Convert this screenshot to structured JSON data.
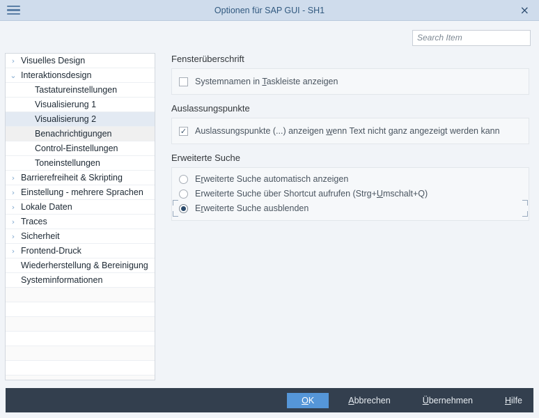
{
  "window": {
    "title": "Optionen für SAP GUI - SH1",
    "menu_icon": "hamburger-icon",
    "close_icon": "×"
  },
  "search": {
    "placeholder": "Search Item",
    "value": ""
  },
  "sidebar": {
    "items": [
      {
        "label": "Visuelles Design",
        "level": 1,
        "chevron": "›",
        "state": "collapsed"
      },
      {
        "label": "Interaktionsdesign",
        "level": 1,
        "chevron": "⌄",
        "state": "expanded"
      },
      {
        "label": "Tastatureinstellungen",
        "level": 2,
        "chevron": "",
        "state": "leaf"
      },
      {
        "label": "Visualisierung 1",
        "level": 2,
        "chevron": "",
        "state": "leaf"
      },
      {
        "label": "Visualisierung 2",
        "level": 2,
        "chevron": "",
        "state": "selected"
      },
      {
        "label": "Benachrichtigungen",
        "level": 2,
        "chevron": "",
        "state": "hover"
      },
      {
        "label": "Control-Einstellungen",
        "level": 2,
        "chevron": "",
        "state": "leaf"
      },
      {
        "label": "Toneinstellungen",
        "level": 2,
        "chevron": "",
        "state": "leaf"
      },
      {
        "label": "Barrierefreiheit & Skripting",
        "level": 1,
        "chevron": "›",
        "state": "collapsed"
      },
      {
        "label": "Einstellung - mehrere Sprachen",
        "level": 1,
        "chevron": "›",
        "state": "collapsed"
      },
      {
        "label": "Lokale Daten",
        "level": 1,
        "chevron": "›",
        "state": "collapsed"
      },
      {
        "label": "Traces",
        "level": 1,
        "chevron": "›",
        "state": "collapsed"
      },
      {
        "label": "Sicherheit",
        "level": 1,
        "chevron": "›",
        "state": "collapsed"
      },
      {
        "label": "Frontend-Druck",
        "level": 1,
        "chevron": "›",
        "state": "collapsed"
      },
      {
        "label": "Wiederherstellung & Bereinigung",
        "level": 1,
        "chevron": "",
        "state": "leaf"
      },
      {
        "label": "Systeminformationen",
        "level": 1,
        "chevron": "",
        "state": "leaf"
      }
    ],
    "empty_row_count": 7
  },
  "main": {
    "groups": [
      {
        "title": "Fensterüberschrift",
        "control": "checkbox",
        "options": [
          {
            "label_before": "Systemnamen in ",
            "accel": "T",
            "label_after": "askleiste anzeigen",
            "checked": false
          }
        ]
      },
      {
        "title": "Auslassungspunkte",
        "control": "checkbox",
        "options": [
          {
            "label_before": "Auslassungspunkte (...) anzeigen ",
            "accel": "w",
            "label_after": "enn Text nicht ganz angezeigt werden kann",
            "checked": true
          }
        ]
      },
      {
        "title": "Erweiterte Suche",
        "control": "radio",
        "options": [
          {
            "label_before": "E",
            "accel": "r",
            "label_after": "weiterte Suche automatisch anzeigen",
            "selected": false,
            "focused": false
          },
          {
            "label_before": "Erweiterte Suche über Shortcut aufrufen (Strg+",
            "accel": "U",
            "label_after": "mschalt+Q)",
            "selected": false,
            "focused": false
          },
          {
            "label_before": "E",
            "accel": "r",
            "label_after": "weiterte Suche ausblenden",
            "selected": true,
            "focused": true
          }
        ]
      }
    ]
  },
  "footer": {
    "buttons": [
      {
        "before": "",
        "accel": "O",
        "after": "K",
        "style": "primary"
      },
      {
        "before": "",
        "accel": "A",
        "after": "bbrechen",
        "style": "ghost"
      },
      {
        "before": "",
        "accel": "Ü",
        "after": "bernehmen",
        "style": "ghost"
      },
      {
        "before": "",
        "accel": "H",
        "after": "ilfe",
        "style": "ghost"
      }
    ]
  },
  "colors": {
    "titlebar": "#cfdcec",
    "title_text": "#31597f",
    "background": "#f1f4f8",
    "footer": "#333f4e",
    "primary_button": "#5596d8",
    "selected_row": "#e3eaf3",
    "hover_row": "#f0f0f0",
    "radio_dot": "#2a4a6b"
  }
}
